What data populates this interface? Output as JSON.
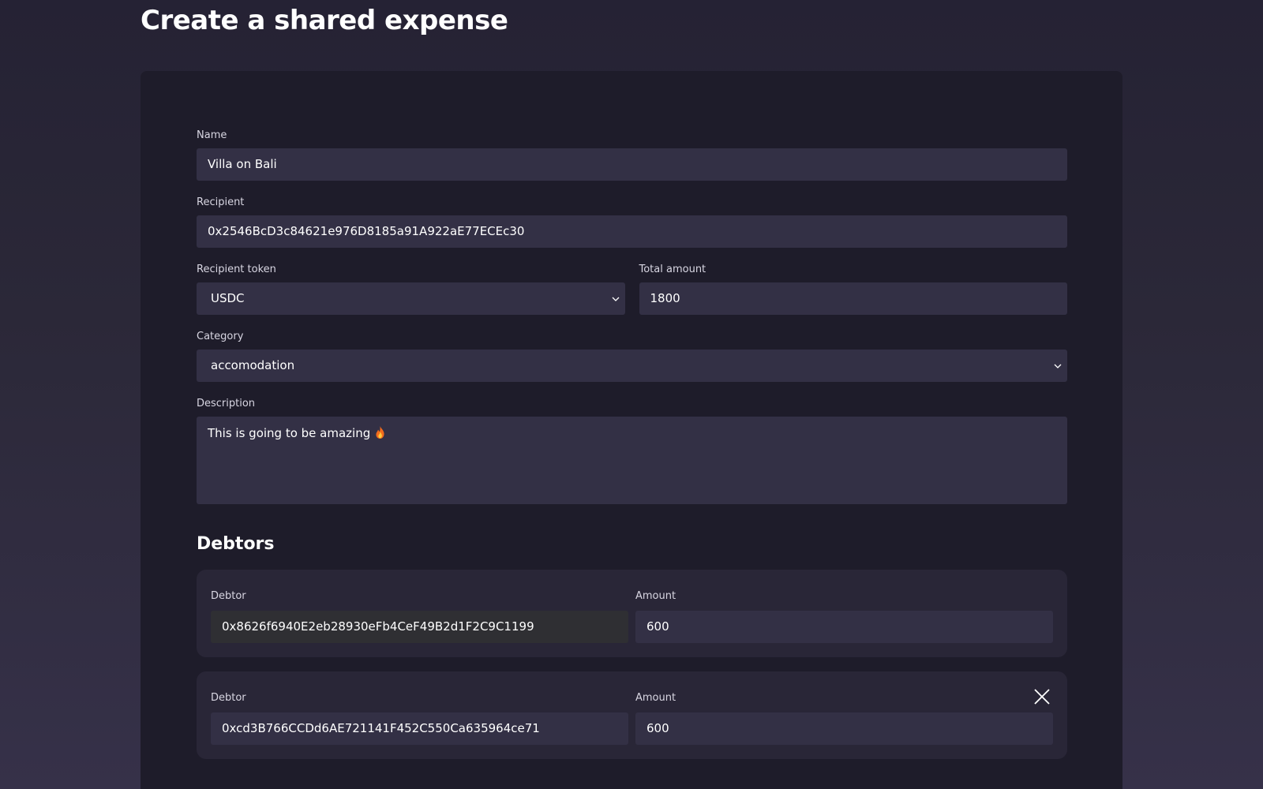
{
  "page": {
    "title": "Create a shared expense"
  },
  "form": {
    "name": {
      "label": "Name",
      "value": "Villa on Bali"
    },
    "recipient": {
      "label": "Recipient",
      "value": "0x2546BcD3c84621e976D8185a91A922aE77ECEc30"
    },
    "recipient_token": {
      "label": "Recipient token",
      "value": "USDC"
    },
    "total_amount": {
      "label": "Total amount",
      "value": "1800"
    },
    "category": {
      "label": "Category",
      "value": "accomodation"
    },
    "description": {
      "label": "Description",
      "value": "This is going to be amazing"
    }
  },
  "debtors": {
    "title": "Debtors",
    "items": [
      {
        "debtor_label": "Debtor",
        "debtor": "0x8626f6940E2eb28930eFb4CeF49B2d1F2C9C1199",
        "amount_label": "Amount",
        "amount": "600",
        "removable": false
      },
      {
        "debtor_label": "Debtor",
        "debtor": "0xcd3B766CCDd6AE721141F452C550Ca635964ce71",
        "amount_label": "Amount",
        "amount": "600",
        "removable": true
      }
    ]
  },
  "icons": {
    "chevron": "chevron-down-icon",
    "close": "close-icon",
    "emoji": "fire-emoji"
  },
  "colors": {
    "background": "#2b2838",
    "card": "#1e1c2a",
    "field": "#333045",
    "debtor_card": "#292637",
    "text": "#ffffff"
  }
}
